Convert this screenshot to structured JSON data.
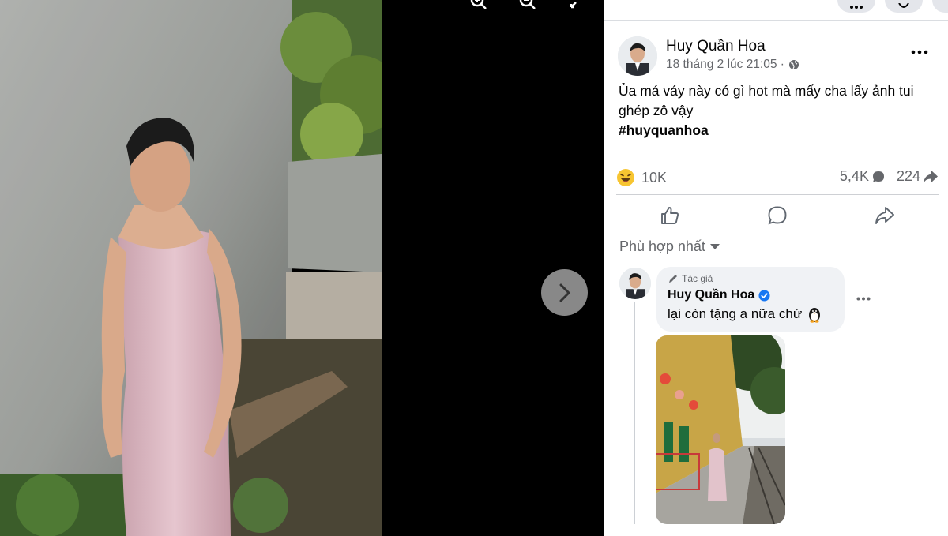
{
  "post": {
    "author": "Huy Quần Hoa",
    "timestamp": "18 tháng 2 lúc 21:05 ·",
    "text": "Ủa má váy này có gì hot mà mấy cha lấy ảnh tui ghép zô vậy",
    "hashtag": "#huyquanhoa",
    "reactions": "10K",
    "comments": "5,4K",
    "shares": "224"
  },
  "comments_section": {
    "sort_label": "Phù hợp nhất"
  },
  "comment": {
    "badge": "Tác giả",
    "author": "Huy Quần Hoa",
    "text": "lại còn tặng a nữa chứ"
  },
  "icons": {
    "zoom_in": "zoom-in-icon",
    "zoom_out": "zoom-out-icon",
    "fullscreen": "fullscreen-icon",
    "next": "chevron-right-icon",
    "like": "thumbs-up-icon",
    "comment": "speech-bubble-icon",
    "share": "share-arrow-icon",
    "privacy": "globe-icon",
    "reaction": "laughing-emoji-icon",
    "verified": "verified-badge-icon"
  },
  "colors": {
    "accent": "#1877f2",
    "text_primary": "#050505",
    "text_secondary": "#65676b",
    "bubble": "#f0f2f5"
  }
}
